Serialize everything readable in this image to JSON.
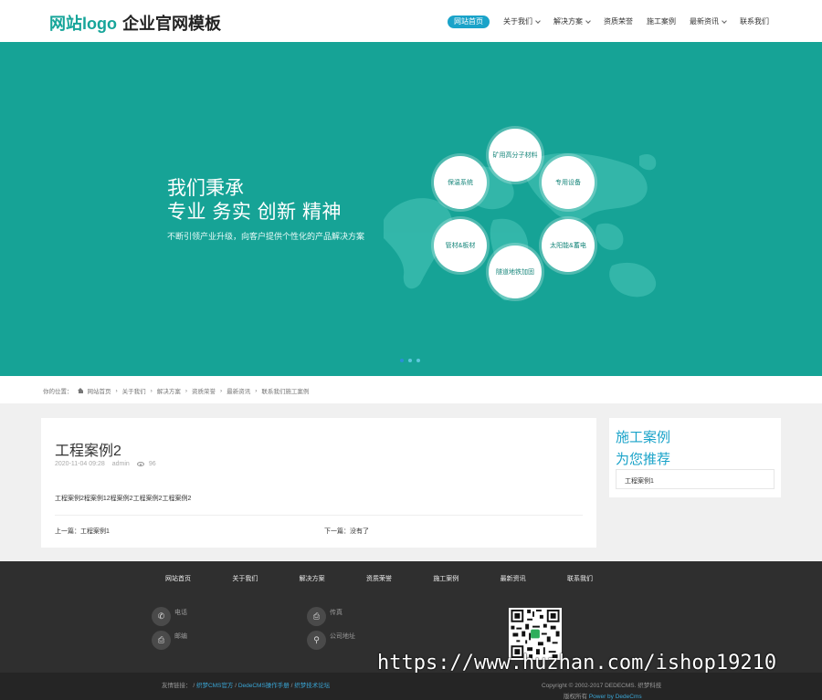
{
  "header": {
    "logo": "网站logo",
    "brand": "企业官网模板",
    "nav": [
      {
        "label": "网站首页",
        "active": true,
        "dropdown": false
      },
      {
        "label": "关于我们",
        "active": false,
        "dropdown": true
      },
      {
        "label": "解决方案",
        "active": false,
        "dropdown": true
      },
      {
        "label": "资质荣誉",
        "active": false,
        "dropdown": false
      },
      {
        "label": "施工案例",
        "active": false,
        "dropdown": false
      },
      {
        "label": "最新资讯",
        "active": false,
        "dropdown": true
      },
      {
        "label": "联系我们",
        "active": false,
        "dropdown": false
      }
    ]
  },
  "banner": {
    "line1": "我们秉承",
    "line2": "专业 务实 创新 精神",
    "sub": "不断引领产业升级，向客户提供个性化的产品解决方案",
    "circles": [
      "矿用高分子材料",
      "专用设备",
      "太阳能&蓄电",
      "隧道地铁加固",
      "管材&板材",
      "保温系统"
    ],
    "slide_count": 3,
    "active_slide": 1
  },
  "breadcrumb": {
    "prefix": "你的位置：",
    "items": [
      "网站首页",
      "关于我们",
      "解决方案",
      "资质荣誉",
      "最新资讯",
      "联系我们施工案例"
    ]
  },
  "article": {
    "title": "工程案例2",
    "date": "2020-11-04 09:28",
    "author": "admin",
    "views": "96",
    "body": "工程案例2程案例12程案例2工程案例2工程案例2",
    "prev": "上一篇：工程案例1",
    "next": "下一篇：没有了"
  },
  "sidebar": {
    "title1": "施工案例",
    "title2": "为您推荐",
    "items": [
      "工程案例1"
    ]
  },
  "footer": {
    "nav": [
      "网站首页",
      "关于我们",
      "解决方案",
      "资质荣誉",
      "施工案例",
      "最新资讯",
      "联系我们"
    ],
    "contacts": {
      "phone": "电话",
      "fax": "传真",
      "postcode": "邮编",
      "address": "公司地址"
    },
    "watermark": "https://www.huzhan.com/ishop19210"
  },
  "bottom": {
    "links_label": "友情链接：",
    "links": [
      "织梦CMS官方",
      "DedeCMS操作手册",
      "织梦技术论坛"
    ],
    "copyright": "Copyright © 2002-2017 DEDECMS. 织梦科技",
    "rights_prefix": "版权所有",
    "powered": "Power by DedeCms"
  },
  "colors": {
    "accent": "#17a59a",
    "nav_active": "#1aa3c9",
    "banner_bg": "#16a396",
    "footer_bg": "#2f2f2f",
    "bottom_bg": "#252525",
    "link": "#3aa6d6"
  }
}
